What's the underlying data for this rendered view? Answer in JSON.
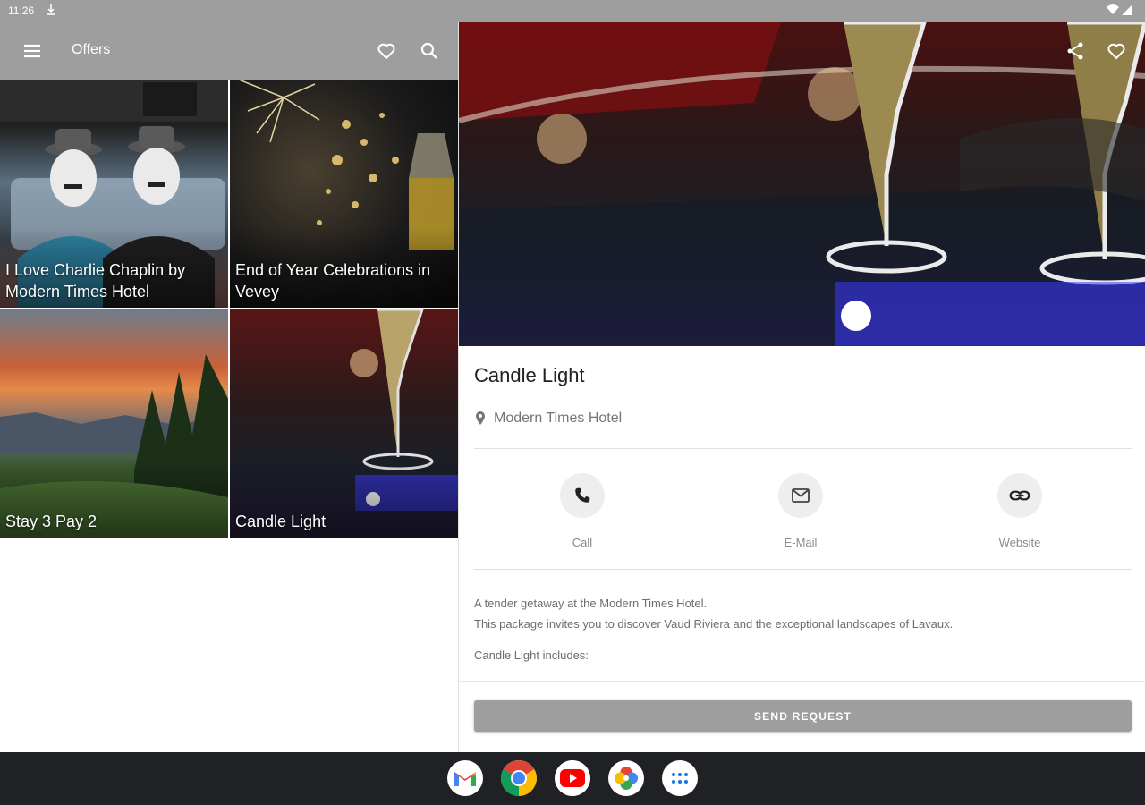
{
  "status_bar": {
    "time": "11:26"
  },
  "app_bar": {
    "title": "Offers"
  },
  "offers": [
    {
      "label": "I Love Charlie Chaplin by Modern Times Hotel"
    },
    {
      "label": "End of Year Celebrations in Vevey"
    },
    {
      "label": "Stay 3 Pay 2"
    },
    {
      "label": "Candle Light"
    }
  ],
  "detail": {
    "title": "Candle Light",
    "location": "Modern Times Hotel",
    "actions": [
      {
        "label": "Call",
        "icon": "phone-icon"
      },
      {
        "label": "E-Mail",
        "icon": "mail-icon"
      },
      {
        "label": "Website",
        "icon": "link-icon"
      }
    ],
    "description": [
      "A tender getaway at the Modern Times Hotel.",
      "This package invites you to discover Vaud Riviera and the exceptional landscapes of Lavaux."
    ],
    "includes": "Candle Light includes:",
    "send_label": "SEND REQUEST"
  },
  "dock": [
    "Gmail",
    "Chrome",
    "YouTube",
    "Photos",
    "App launcher"
  ],
  "colors": {
    "app_bar": "#9e9e9e",
    "nav_bar": "#202124",
    "button": "#9e9e9e"
  }
}
